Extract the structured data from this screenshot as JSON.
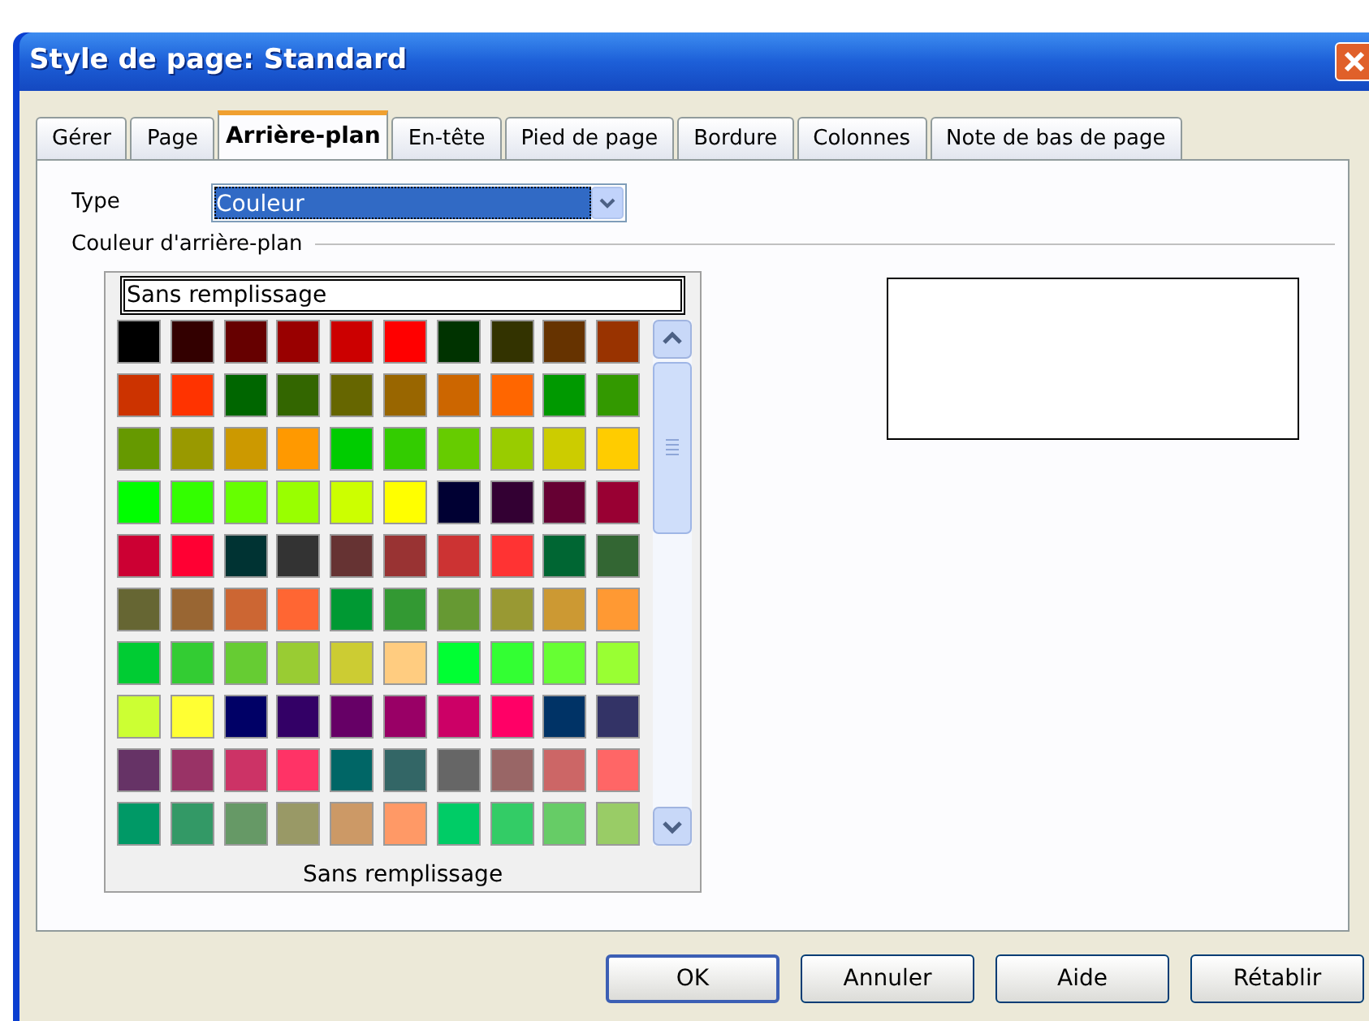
{
  "window": {
    "title": "Style de page: Standard"
  },
  "tabs": [
    {
      "label": "Gérer",
      "selected": false
    },
    {
      "label": "Page",
      "selected": false
    },
    {
      "label": "Arrière-plan",
      "selected": true
    },
    {
      "label": "En-tête",
      "selected": false
    },
    {
      "label": "Pied de page",
      "selected": false
    },
    {
      "label": "Bordure",
      "selected": false
    },
    {
      "label": "Colonnes",
      "selected": false
    },
    {
      "label": "Note de bas de page",
      "selected": false
    }
  ],
  "type_field": {
    "label": "Type",
    "value": "Couleur"
  },
  "section_title": "Couleur d'arrière-plan",
  "color_list": {
    "selected_name": "Sans remplissage",
    "footer_label": "Sans remplissage",
    "swatches": [
      {
        "color": "#000000"
      },
      {
        "color": "#330000"
      },
      {
        "color": "#660000"
      },
      {
        "color": "#990000"
      },
      {
        "color": "#cc0000"
      },
      {
        "color": "#ff0000"
      },
      {
        "color": "#003300"
      },
      {
        "color": "#333300"
      },
      {
        "color": "#663300"
      },
      {
        "color": "#993300"
      },
      {
        "color": "#cc3300"
      },
      {
        "color": "#ff3300"
      },
      {
        "color": "#006600"
      },
      {
        "color": "#336600"
      },
      {
        "color": "#666600"
      },
      {
        "color": "#996600"
      },
      {
        "color": "#cc6600"
      },
      {
        "color": "#ff6600"
      },
      {
        "color": "#009900"
      },
      {
        "color": "#339900"
      },
      {
        "color": "#669900"
      },
      {
        "color": "#999900"
      },
      {
        "color": "#cc9900"
      },
      {
        "color": "#ff9900"
      },
      {
        "color": "#00cc00"
      },
      {
        "color": "#33cc00"
      },
      {
        "color": "#66cc00"
      },
      {
        "color": "#99cc00"
      },
      {
        "color": "#cccc00"
      },
      {
        "color": "#ffcc00"
      },
      {
        "color": "#00ff00"
      },
      {
        "color": "#33ff00"
      },
      {
        "color": "#66ff00"
      },
      {
        "color": "#99ff00"
      },
      {
        "color": "#ccff00"
      },
      {
        "color": "#ffff00"
      },
      {
        "color": "#000033"
      },
      {
        "color": "#330033"
      },
      {
        "color": "#660033"
      },
      {
        "color": "#990033"
      },
      {
        "color": "#cc0033"
      },
      {
        "color": "#ff0033"
      },
      {
        "color": "#003333"
      },
      {
        "color": "#333333"
      },
      {
        "color": "#663333"
      },
      {
        "color": "#993333"
      },
      {
        "color": "#cc3333"
      },
      {
        "color": "#ff3333"
      },
      {
        "color": "#006633"
      },
      {
        "color": "#336633"
      },
      {
        "color": "#666633"
      },
      {
        "color": "#996633"
      },
      {
        "color": "#cc6633"
      },
      {
        "color": "#ff6633"
      },
      {
        "color": "#009933"
      },
      {
        "color": "#339933"
      },
      {
        "color": "#669933"
      },
      {
        "color": "#999933"
      },
      {
        "color": "#cc9933"
      },
      {
        "color": "#ff9933"
      },
      {
        "color": "#00cc33"
      },
      {
        "color": "#33cc33"
      },
      {
        "color": "#66cc33"
      },
      {
        "color": "#99cc33"
      },
      {
        "color": "#cccc33"
      },
      {
        "color": "#ffcc80"
      },
      {
        "color": "#00ff33"
      },
      {
        "color": "#33ff33"
      },
      {
        "color": "#66ff33"
      },
      {
        "color": "#99ff33"
      },
      {
        "color": "#ccff33"
      },
      {
        "color": "#ffff33"
      },
      {
        "color": "#000066"
      },
      {
        "color": "#330066"
      },
      {
        "color": "#660066"
      },
      {
        "color": "#990066"
      },
      {
        "color": "#cc0066"
      },
      {
        "color": "#ff0066"
      },
      {
        "color": "#003366"
      },
      {
        "color": "#333366"
      },
      {
        "color": "#663366"
      },
      {
        "color": "#993366"
      },
      {
        "color": "#cc3366"
      },
      {
        "color": "#ff3366"
      },
      {
        "color": "#006666"
      },
      {
        "color": "#336666"
      },
      {
        "color": "#666666"
      },
      {
        "color": "#996666"
      },
      {
        "color": "#cc6666"
      },
      {
        "color": "#ff6666"
      },
      {
        "color": "#009966"
      },
      {
        "color": "#339966"
      },
      {
        "color": "#669966"
      },
      {
        "color": "#999966"
      },
      {
        "color": "#cc9966"
      },
      {
        "color": "#ff9966"
      },
      {
        "color": "#00cc66"
      },
      {
        "color": "#33cc66"
      },
      {
        "color": "#66cc66"
      },
      {
        "color": "#99cc66"
      }
    ]
  },
  "buttons": [
    {
      "label": "OK",
      "default": true
    },
    {
      "label": "Annuler",
      "default": false
    },
    {
      "label": "Aide",
      "default": false
    },
    {
      "label": "Rétablir",
      "default": false
    }
  ]
}
